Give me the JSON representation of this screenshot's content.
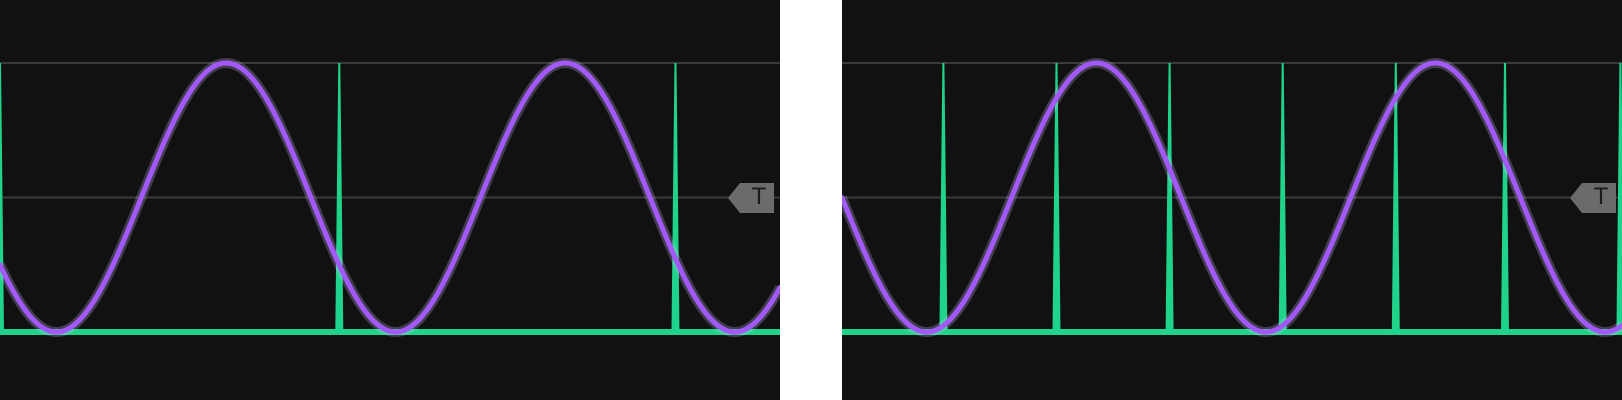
{
  "colors": {
    "background": "#111112",
    "gap": "#ffffff",
    "grid": "#3a3a3a",
    "sine": "#a259f7",
    "pulse": "#1fd48a",
    "trigger_marker": "#6b6b6b"
  },
  "icons": {
    "trigger": "trigger-level-marker"
  },
  "chart_data": [
    {
      "type": "line",
      "title": "",
      "xlabel": "",
      "ylabel": "",
      "xlim": [
        0,
        1
      ],
      "ylim": [
        0,
        1
      ],
      "grid": true,
      "grid_y": [
        0.5,
        1.0
      ],
      "trigger": {
        "label": "T",
        "level": 0.5
      },
      "series": [
        {
          "kind": "sine",
          "color": "#a259f7",
          "cycles": 2.3,
          "phase_deg": 210,
          "min": 0.0,
          "max": 1.0
        },
        {
          "kind": "pulse",
          "color": "#1fd48a",
          "baseline": 0.0,
          "height": 1.0,
          "x": [
            0.0,
            0.435,
            0.866
          ]
        }
      ]
    },
    {
      "type": "line",
      "title": "",
      "xlabel": "",
      "ylabel": "",
      "xlim": [
        0,
        1
      ],
      "ylim": [
        0,
        1
      ],
      "grid": true,
      "grid_y": [
        0.5,
        1.0
      ],
      "trigger": {
        "label": "T",
        "level": 0.5
      },
      "series": [
        {
          "kind": "sine",
          "color": "#a259f7",
          "cycles": 2.3,
          "phase_deg": 180,
          "min": 0.0,
          "max": 1.0
        },
        {
          "kind": "pulse",
          "color": "#1fd48a",
          "baseline": 0.0,
          "height": 1.0,
          "x": [
            0.13,
            0.275,
            0.42,
            0.565,
            0.71,
            0.85,
            0.998
          ]
        }
      ]
    }
  ]
}
